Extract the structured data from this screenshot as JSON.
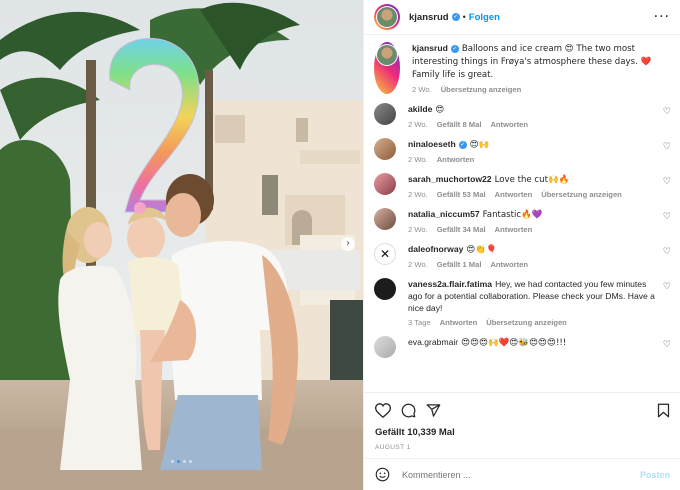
{
  "post": {
    "username": "kjansrud",
    "follow_label": "Folgen",
    "more_icon": "more-horizontal-icon",
    "separator": "•",
    "caption": {
      "text": "Balloons and ice cream 😍 The two most interesting things in Frøya's atmosphere these days. ❤️Family life is great.",
      "time": "2 Wo.",
      "translate": "Übersetzung anzeigen"
    },
    "likes": "Gefällt 10,339 Mal",
    "date": "AUGUST 1",
    "comment_placeholder": "Kommentieren ...",
    "post_label": "Posten",
    "photo_dots": 4,
    "photo_active_dot": 1
  },
  "comments": [
    {
      "user": "akilde",
      "text": "😍",
      "time": "2 Wo.",
      "likes": "Gefällt 8 Mal",
      "reply": "Antworten",
      "translate": "",
      "verified": false
    },
    {
      "user": "ninaloeseth",
      "text": "😍🙌",
      "time": "2 Wo.",
      "likes": "",
      "reply": "Antworten",
      "translate": "",
      "verified": true
    },
    {
      "user": "sarah_muchortow22",
      "text": "Love the cut🙌🔥",
      "time": "2 Wo.",
      "likes": "Gefällt 53 Mal",
      "reply": "Antworten",
      "translate": "Übersetzung anzeigen",
      "verified": false
    },
    {
      "user": "natalia_niccum57",
      "text": "Fantastic🔥💜",
      "time": "2 Wo.",
      "likes": "Gefällt 34 Mal",
      "reply": "Antworten",
      "translate": "",
      "verified": false
    },
    {
      "user": "daleofnorway",
      "text": "😍👏🎈",
      "time": "2 Wo.",
      "likes": "Gefällt 1 Mal",
      "reply": "Antworten",
      "translate": "",
      "verified": false
    },
    {
      "user": "vaness2a.flair.fatima",
      "text": "Hey, we had contacted you few minutes ago for a potential collaboration. Please check your DMs. Have a nice day!",
      "time": "3 Tage",
      "likes": "",
      "reply": "Antworten",
      "translate": "Übersetzung anzeigen",
      "verified": false
    },
    {
      "user": "eva.grabmair",
      "text": "😍😍😍🙌❤️😍🐝😍😍😍!!!",
      "time": "",
      "likes": "",
      "reply": "",
      "translate": "",
      "verified": false
    }
  ],
  "icons": {
    "like": "heart-icon",
    "comment": "comment-icon",
    "share": "send-icon",
    "save": "bookmark-icon",
    "emoji": "emoji-icon",
    "next": "chevron-right-icon"
  },
  "colors": {
    "link_blue": "#0095f6",
    "verified_blue": "#3897f0",
    "muted": "#8e8e8e",
    "disabled_post": "#b2dffc"
  }
}
